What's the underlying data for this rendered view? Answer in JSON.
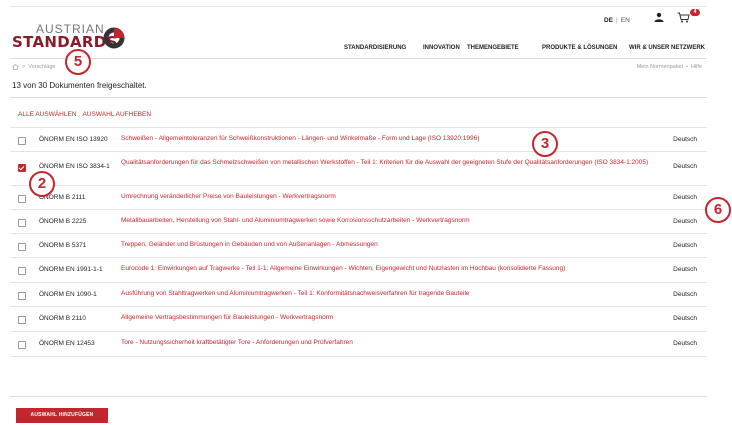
{
  "header": {
    "logo_top": "AUSTRIAN",
    "logo_bottom": "STANDARDS",
    "lang_active": "DE",
    "lang_other": "EN",
    "cart_count": "4",
    "nav": [
      "STANDARDISIERUNG",
      "INNOVATION",
      "THEMENGEBIETE",
      "PRODUKTE & LÖSUNGEN",
      "WIR & UNSER NETZWERK"
    ]
  },
  "breadcrumb": {
    "current": "Vorschläge",
    "right_links": [
      "Mein Normenpaket",
      "Hilfe"
    ]
  },
  "summary": "13 von 30 Dokumenten freigeschaltet.",
  "bulk_actions": {
    "select_all": "ALLE AUSWÄHLEN",
    "clear": "AUSWAHL AUFHEBEN"
  },
  "rows": [
    {
      "code": "ÖNORM EN ISO 13920",
      "title": "Schweißen - Allgemeintoleranzen für Schweißkonstruktionen - Längen- und Winkelmaße - Form und Lage (ISO 13920:1996)",
      "language": "Deutsch",
      "checked": false
    },
    {
      "code": "ÖNORM EN ISO 3834-1",
      "title": "Qualitätsanforderungen für das Schmelzschweißen von metallischen Werkstoffen - Teil 1: Kriterien für die Auswahl der geeigneten Stufe der Qualitätsanforderungen (ISO 3834-1:2005)",
      "language": "Deutsch",
      "checked": true
    },
    {
      "code": "ÖNORM B 2111",
      "title": "Umrechnung veränderlicher Preise von Bauleistungen - Werkvertragsnorm",
      "language": "Deutsch",
      "checked": false
    },
    {
      "code": "ÖNORM B 2225",
      "title": "Metallbauarbeiten, Herstellung von Stahl- und Aluminiumtragwerken sowie Korrosionsschutzarbeiten - Werkvertragsnorm",
      "language": "Deutsch",
      "checked": false
    },
    {
      "code": "ÖNORM B 5371",
      "title": "Treppen, Geländer und Brüstungen in Gebäuden und von Außenanlagen - Abmessungen",
      "language": "Deutsch",
      "checked": false
    },
    {
      "code": "ÖNORM EN 1991-1-1",
      "title": "Eurocode 1: Einwirkungen auf Tragwerke - Teil 1-1: Allgemeine Einwirkungen - Wichten, Eigengewicht und Nutzlasten im Hochbau (konsolidierte Fassung)",
      "language": "Deutsch",
      "checked": false
    },
    {
      "code": "ÖNORM EN 1090-1",
      "title": "Ausführung von Stahltragwerken und Aluminiumtragwerken - Teil 1: Konformitätsnachweisverfahren für tragende Bauteile",
      "language": "Deutsch",
      "checked": false
    },
    {
      "code": "ÖNORM B 2110",
      "title": "Allgemeine Vertragsbestimmungen für Bauleistungen - Werkvertragsnorm",
      "language": "Deutsch",
      "checked": false
    },
    {
      "code": "ÖNORM EN 12453",
      "title": "Tore - Nutzungssicherheit kraftbetätigter Tore - Anforderungen und Prüfverfahren",
      "language": "Deutsch",
      "checked": false
    }
  ],
  "add_button": "AUSWAHL HINZUFÜGEN",
  "annotation_markers": [
    "5",
    "2",
    "3",
    "6"
  ],
  "colors": {
    "accent": "#c4262e",
    "brand": "#8a1b2a"
  }
}
